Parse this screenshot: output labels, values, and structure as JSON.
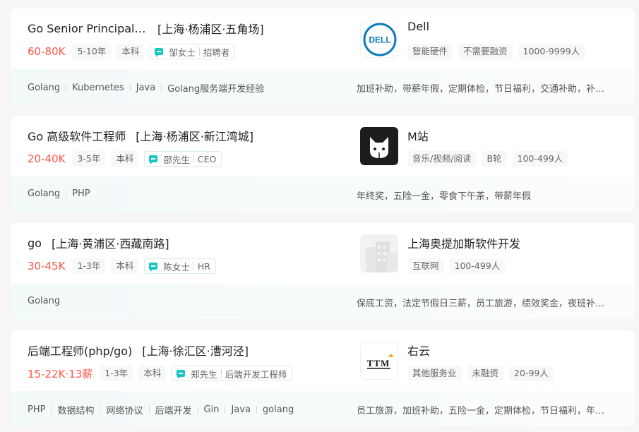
{
  "jobs": [
    {
      "title": "Go Senior Principal S...",
      "area": "[上海·杨浦区·五角场]",
      "salary": "60-80K",
      "tags": [
        "5-10年",
        "本科"
      ],
      "recruiter_name": "邹女士",
      "recruiter_title": "招聘者",
      "skills": [
        "Golang",
        "Kubernetes",
        "Java",
        "Golang服务端开发经验"
      ],
      "company": "Dell",
      "company_tags": [
        "智能硬件",
        "不需要融资",
        "1000-9999人"
      ],
      "benefits": "加班补助，带薪年假，定期体检，节日福利，交通补助，补…",
      "logo_text": "DELL"
    },
    {
      "title": "Go 高级软件工程师",
      "area": "[上海·杨浦区·新江湾城]",
      "salary": "20-40K",
      "tags": [
        "3-5年",
        "本科"
      ],
      "recruiter_name": "邵先生",
      "recruiter_title": "CEO",
      "skills": [
        "Golang",
        "PHP"
      ],
      "company": "M站",
      "company_tags": [
        "音乐/视频/阅读",
        "B轮",
        "100-499人"
      ],
      "benefits": "年终奖，五险一金，零食下午茶，带薪年假"
    },
    {
      "title": "go",
      "area": "[上海·黄浦区·西藏南路]",
      "salary": "30-45K",
      "tags": [
        "1-3年",
        "本科"
      ],
      "recruiter_name": "陈女士",
      "recruiter_title": "HR",
      "skills": [
        "Golang"
      ],
      "company": "上海奥提加斯软件开发",
      "company_tags": [
        "互联网",
        "100-499人"
      ],
      "benefits": "保底工资，法定节假日三薪，员工旅游，绩效奖金，夜班补…"
    },
    {
      "title": "后端工程师(php/go)",
      "area": "[上海·徐汇区·漕河泾]",
      "salary": "15-22K·13薪",
      "tags": [
        "1-3年",
        "本科"
      ],
      "recruiter_name": "郑先生",
      "recruiter_title": "后端开发工程师",
      "skills": [
        "PHP",
        "数据结构",
        "网络协议",
        "后端开发",
        "Gin",
        "Java",
        "golang"
      ],
      "company": "右云",
      "company_tags": [
        "其他服务业",
        "未融资",
        "20-99人"
      ],
      "benefits": "员工旅游，加班补助，五险一金，定期体检，节日福利，年…",
      "logo_text": "TTM"
    }
  ],
  "colors": {
    "salary": "#fe574a",
    "accent": "#18c6c6",
    "dell_blue": "#0b7bc1"
  }
}
